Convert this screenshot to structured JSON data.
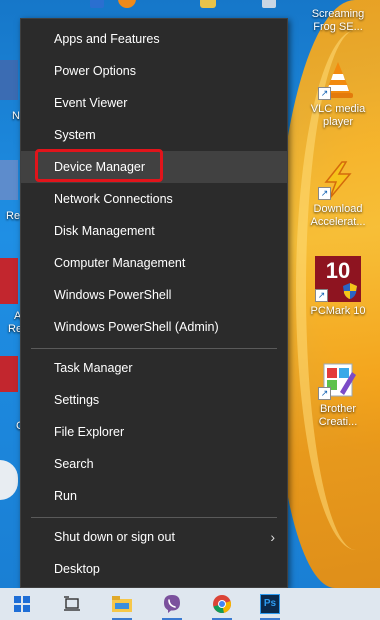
{
  "desktop": {
    "icons": [
      {
        "label": "Screaming Frog SE...",
        "icon": "screaming-frog-icon"
      },
      {
        "label": "VLC media player",
        "icon": "vlc-icon"
      },
      {
        "label": "Download Accelerat...",
        "icon": "download-accelerator-icon"
      },
      {
        "label": "PCMark 10",
        "icon": "pcmark-icon",
        "badge": "10"
      },
      {
        "label": "Brother Creati...",
        "icon": "brother-creative-icon"
      }
    ],
    "edge_letters": [
      "N",
      "Re",
      "A",
      "Re",
      "C"
    ]
  },
  "menu": {
    "group1": [
      {
        "label": "Apps and Features"
      },
      {
        "label": "Power Options"
      },
      {
        "label": "Event Viewer"
      },
      {
        "label": "System"
      },
      {
        "label": "Device Manager"
      },
      {
        "label": "Network Connections"
      },
      {
        "label": "Disk Management"
      },
      {
        "label": "Computer Management"
      },
      {
        "label": "Windows PowerShell"
      },
      {
        "label": "Windows PowerShell (Admin)"
      }
    ],
    "group2": [
      {
        "label": "Task Manager"
      },
      {
        "label": "Settings"
      },
      {
        "label": "File Explorer"
      },
      {
        "label": "Search"
      },
      {
        "label": "Run"
      }
    ],
    "group3": [
      {
        "label": "Shut down or sign out",
        "submenu_glyph": "›"
      },
      {
        "label": "Desktop"
      }
    ],
    "highlighted_item": "Device Manager",
    "highlight_color": "#e1141b"
  },
  "taskbar": {
    "items": [
      "windows-start-icon",
      "task-view-icon",
      "file-explorer-icon",
      "viber-icon",
      "chrome-icon",
      "photoshop-icon"
    ],
    "photoshop_label": "Ps"
  }
}
